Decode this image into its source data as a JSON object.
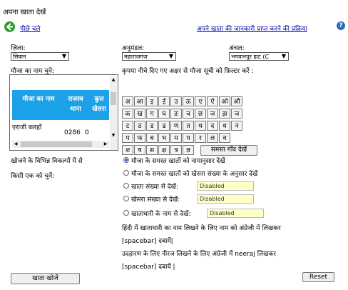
{
  "page": {
    "title": "अपना खाता देखें"
  },
  "nav": {
    "back_label": "पीछे चले",
    "info_link": "अपने खाता की जानकारी प्राप्त करने की प्रक्रिया"
  },
  "filters": {
    "district_label": "ज़िला:",
    "district_value": "सिवान",
    "subdivision_label": "अनुमंडल:",
    "subdivision_value": "महाराजगंज",
    "circle_label": "अंचल:",
    "circle_value": "भगवानपुर हाट (C"
  },
  "mauza": {
    "name_label": "मौजा का नाम चुने:",
    "filter_instruction": "कृपया नीचे दिए गए अक्षर से मौजा सूची को फ़िल्टर करें :",
    "columns": [
      "मौजा का नाम",
      "राजस्व थाना",
      "कुल खेसरा"
    ],
    "rows": [
      [
        "एराजी बलहाँ",
        "0286",
        "0"
      ]
    ]
  },
  "keyboard": {
    "rows": [
      [
        "अ",
        "आ",
        "इ",
        "ई",
        "उ",
        "ऊ",
        "ए",
        "ऐ",
        "ओ",
        "औ"
      ],
      [
        "क",
        "ख",
        "ग",
        "घ",
        "ङ",
        "च",
        "छ",
        "ज",
        "झ",
        "ञ"
      ],
      [
        "ट",
        "ठ",
        "ड",
        "ढ",
        "ण",
        "त",
        "थ",
        "द",
        "ध",
        "न"
      ],
      [
        "प",
        "फ",
        "ब",
        "भ",
        "म",
        "य",
        "र",
        "ल",
        "व"
      ],
      [
        "श",
        "ष",
        "स",
        "क्ष",
        "त्र",
        "ज्ञ"
      ]
    ],
    "all_villages_button": "समस्त गाँव देखें"
  },
  "search": {
    "prompt_line1": "खोजने के विभिन्न विकल्पों में से",
    "prompt_line2": "किसी एक को चुनें:",
    "options": [
      {
        "label": "मौजा के समस्त खातों को नामानुसार देखें",
        "selected": true
      },
      {
        "label": "मौजा के समस्त खातों को खेसरा संख्या के अनुसार देखें",
        "selected": false
      },
      {
        "label": "खाता संख्या से देखें:",
        "selected": false,
        "field": "Disabled"
      },
      {
        "label": "खेसरा संख्या से देखें:",
        "selected": false,
        "field": "Disabled"
      },
      {
        "label": "खाताधारी के नाम से देखें:",
        "selected": false,
        "field": "Disabled"
      }
    ],
    "hint_line1": "हिंदी में खाताधारी का नाम लिखने के लिए नाम को अंग्रेजी में लिखकर",
    "hint_line2": "[spacebar] दबायें|",
    "hint_line3": "उदहारण के लिए नीरज लिखने के लिए अंग्रेजी में neeraj लिखकर",
    "hint_line4": "[spacebar] दबायें |"
  },
  "actions": {
    "search_button": "खाता खोजें",
    "reset_button": "Reset"
  },
  "colors": {
    "header_blue": "#1da1e8",
    "link": "#0000aa",
    "disabled_bg": "#ffffc8"
  }
}
